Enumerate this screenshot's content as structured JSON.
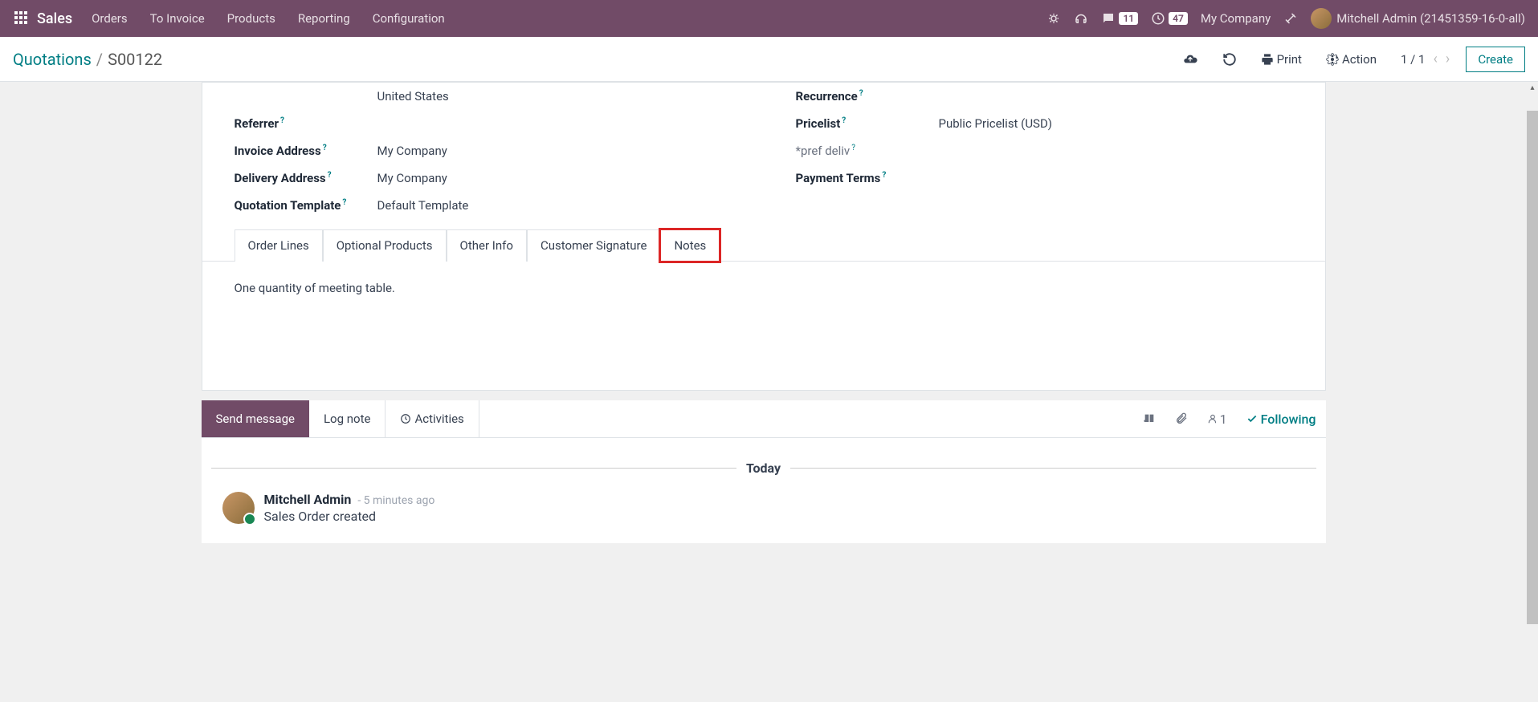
{
  "topnav": {
    "app_name": "Sales",
    "menus": [
      "Orders",
      "To Invoice",
      "Products",
      "Reporting",
      "Configuration"
    ],
    "chat_badge": "11",
    "clock_badge": "47",
    "company": "My Company",
    "user": "Mitchell Admin (21451359-16-0-all)"
  },
  "breadcrumb": {
    "root": "Quotations",
    "current": "S00122"
  },
  "controls": {
    "print": "Print",
    "action": "Action",
    "pager": "1 / 1",
    "create": "Create"
  },
  "form": {
    "left": {
      "shipping_country": "United States",
      "referrer_label": "Referrer",
      "invoice_address_label": "Invoice Address",
      "invoice_address": "My Company",
      "delivery_address_label": "Delivery Address",
      "delivery_address": "My Company",
      "quotation_template_label": "Quotation Template",
      "quotation_template": "Default Template"
    },
    "right": {
      "recurrence_label": "Recurrence",
      "pricelist_label": "Pricelist",
      "pricelist": "Public Pricelist (USD)",
      "pref_deliv_label": "*pref deliv",
      "payment_terms_label": "Payment Terms"
    }
  },
  "tabs": [
    "Order Lines",
    "Optional Products",
    "Other Info",
    "Customer Signature",
    "Notes"
  ],
  "notes_content": "One quantity of meeting table.",
  "chatter": {
    "send": "Send message",
    "log": "Log note",
    "activities": "Activities",
    "follower_count": "1",
    "following": "Following",
    "date": "Today",
    "msg_author": "Mitchell Admin",
    "msg_time": "- 5 minutes ago",
    "msg_text": "Sales Order created"
  }
}
